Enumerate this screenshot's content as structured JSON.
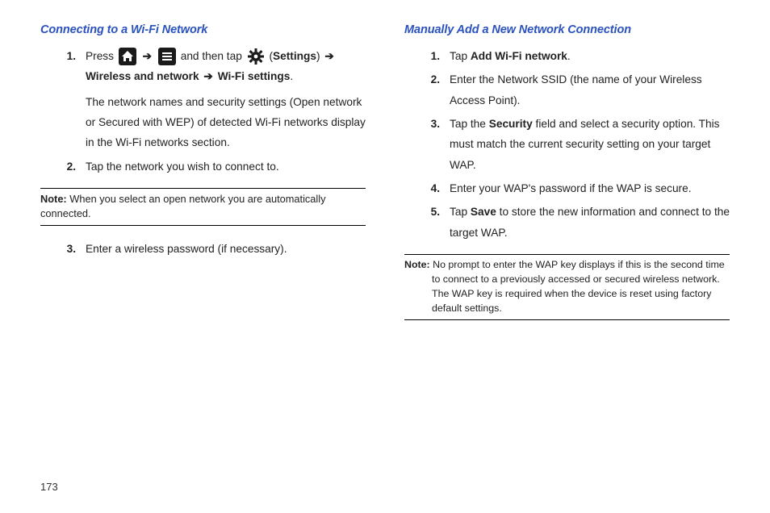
{
  "pageNumber": "173",
  "left": {
    "heading": "Connecting to a Wi-Fi Network",
    "steps": [
      {
        "num": "1.",
        "parts": {
          "p1a": "Press ",
          "p1b": " and then tap ",
          "p1c": " (",
          "settings": "Settings",
          "p1d": ") ",
          "wireless": "Wireless and network",
          "p1e": " ",
          "wifi": "Wi-Fi settings",
          "p1f": ".",
          "para2": "The network names and security settings (Open network or Secured with WEP) of detected Wi-Fi networks display in the Wi-Fi networks section."
        }
      },
      {
        "num": "2.",
        "text": "Tap the network you wish to connect to."
      }
    ],
    "note": {
      "label": "Note:",
      "text": " When you select an open network you are automatically connected."
    },
    "step3": {
      "num": "3.",
      "text": "Enter a wireless password (if necessary)."
    }
  },
  "right": {
    "heading": "Manually Add a New Network Connection",
    "steps": [
      {
        "num": "1.",
        "pre": "Tap ",
        "bold": "Add Wi-Fi network",
        "post": "."
      },
      {
        "num": "2.",
        "text": "Enter the Network SSID (the name of your Wireless Access Point)."
      },
      {
        "num": "3.",
        "pre": "Tap the ",
        "bold": "Security",
        "post": " field and select a security option. This must match the current security setting on your target WAP."
      },
      {
        "num": "4.",
        "text": "Enter your WAP's password if the WAP is secure."
      },
      {
        "num": "5.",
        "pre": "Tap ",
        "bold": "Save",
        "post": " to store the new information and connect to the target WAP."
      }
    ],
    "note": {
      "label": "Note:",
      "text": " No prompt to enter the WAP key displays if this is the second time to connect to a previously accessed or secured wireless network. The WAP key is required when the device is reset using factory default settings."
    }
  },
  "arrow": "➔"
}
